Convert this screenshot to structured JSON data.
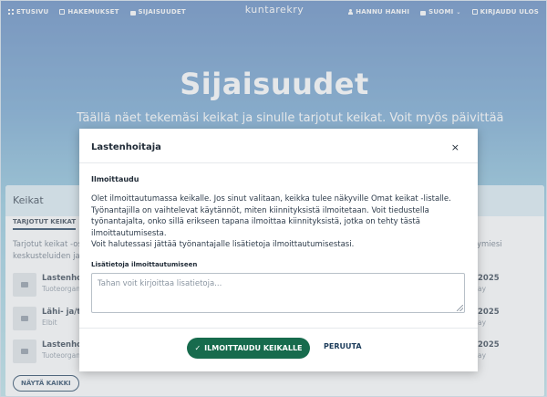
{
  "nav": {
    "left": [
      {
        "icon": "grid-icon",
        "label": "ETUSIVU"
      },
      {
        "icon": "file-icon",
        "label": "HAKEMUKSET"
      },
      {
        "icon": "briefcase-icon",
        "label": "SIJAISUUDET"
      }
    ],
    "brand": "kuntarekry",
    "right": [
      {
        "icon": "user-icon",
        "label": "HANNU HANHI"
      },
      {
        "icon": "chat-icon",
        "label": "SUOMI"
      },
      {
        "icon": "logout-icon",
        "label": "KIRJAUDU ULOS"
      }
    ]
  },
  "hero": {
    "title": "Sijaisuudet",
    "subtitle": "Täällä näet tekemäsi keikat ja sinulle tarjotut keikat. Voit myös päivittää"
  },
  "card": {
    "title": "Keikat",
    "tab": "TARJOTUT KEIKAT",
    "text_line1": "Tarjotut keikat -os",
    "text_line2": "keskusteluiden ja",
    "text_right": "ymiesi",
    "rows": [
      {
        "title": "Lastenhoit",
        "sub": "Tuoteorgan",
        "date": "2025",
        "day": "ay"
      },
      {
        "title": "Lähi- ja/ta",
        "sub": "Elbit",
        "date": "2025",
        "day": "ay"
      },
      {
        "title": "Lastenhoit",
        "sub": "Tuoteorgan",
        "date": "2025",
        "day": "ay"
      }
    ],
    "show_all": "NÄYTÄ KAIKKI"
  },
  "modal": {
    "title": "Lastenhoitaja",
    "close": "×",
    "section": "Ilmoittaudu",
    "paragraph1": "Olet ilmoittautumassa keikalle. Jos sinut valitaan, keikka tulee näkyville Omat keikat -listalle. Työnantajilla on vaihtelevat käytännöt, miten kiinnityksistä ilmoitetaan. Voit tiedustella työnantajalta, onko sillä erikseen tapana ilmoittaa kiinnityksistä, jotka on tehty tästä ilmoittautumisesta.",
    "paragraph2": "Voit halutessasi jättää työnantajalle lisätietoja ilmoittautumisestasi.",
    "label": "Lisätietoja ilmoittautumiseen",
    "placeholder": "Tahan voit kirjoittaa lisatietoja...",
    "value": "",
    "primary_button": "ILMOITTAUDU KEIKALLE",
    "primary_icon": "✓",
    "cancel_button": "PERUUTA"
  }
}
